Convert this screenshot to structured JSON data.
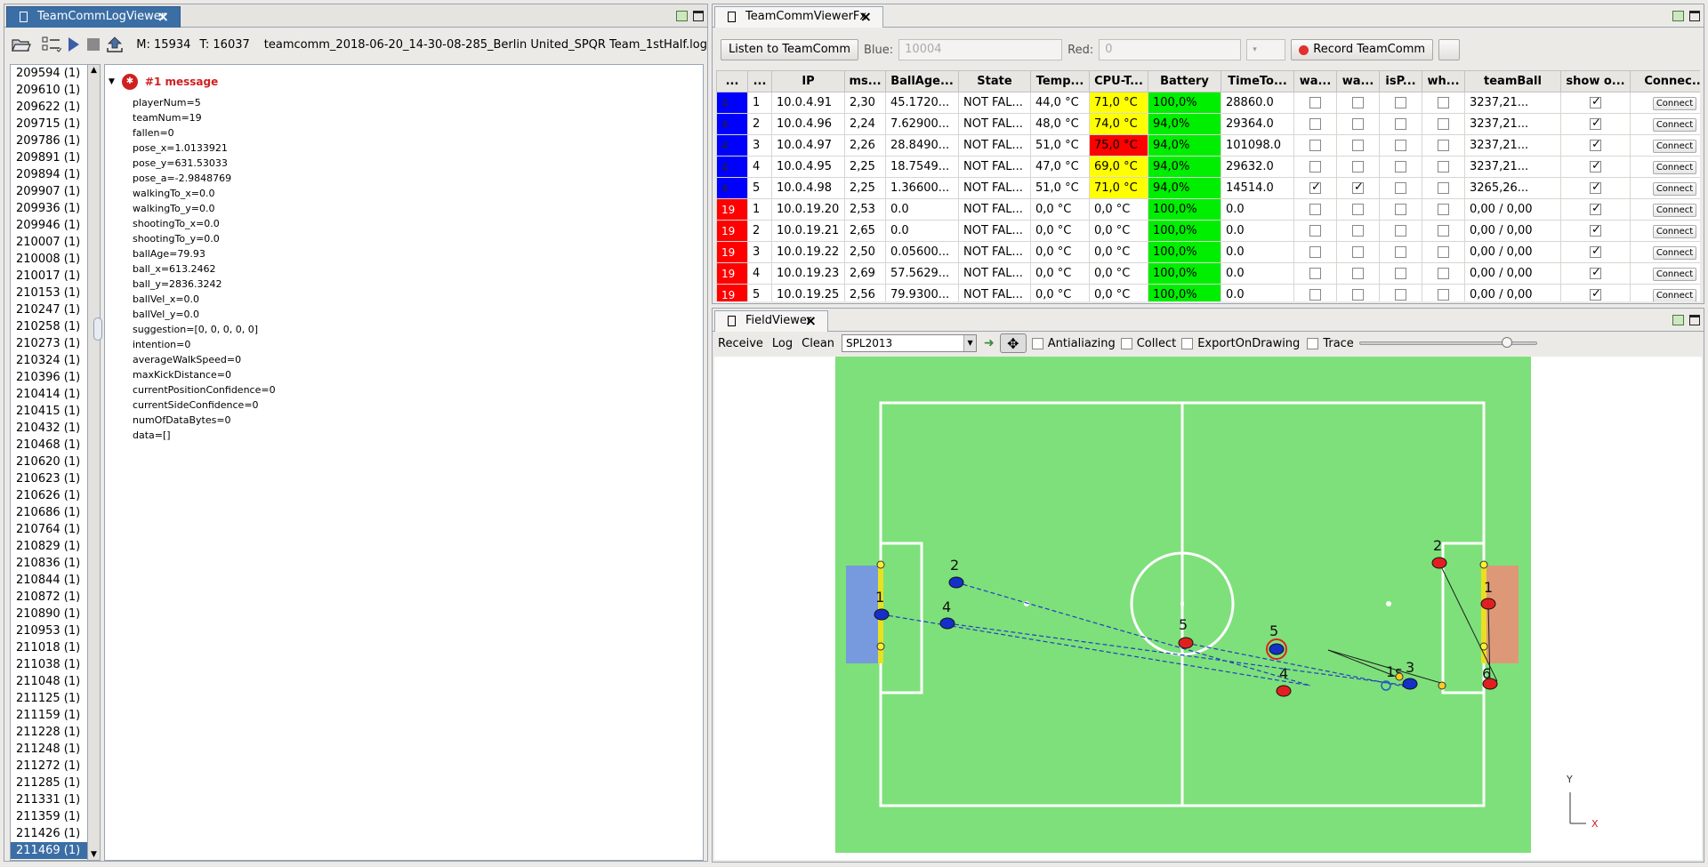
{
  "left_panel": {
    "tab_title": "TeamCommLogViewer",
    "toolbar": {
      "open_icon": "folder-open-icon",
      "filter_icon": "list-check-icon",
      "play_icon": "play-icon",
      "stop_icon": "stop-icon",
      "export_icon": "upload-icon",
      "m_label": "M: 15934",
      "t_label": "T: 16037",
      "filename": "teamcomm_2018-06-20_14-30-08-285_Berlin United_SPQR Team_1stHalf.log"
    },
    "frames": [
      "209594 (1)",
      "209610 (1)",
      "209622 (1)",
      "209715 (1)",
      "209786 (1)",
      "209891 (1)",
      "209894 (1)",
      "209907 (1)",
      "209936 (1)",
      "209946 (1)",
      "210007 (1)",
      "210008 (1)",
      "210017 (1)",
      "210153 (1)",
      "210247 (1)",
      "210258 (1)",
      "210273 (1)",
      "210324 (1)",
      "210396 (1)",
      "210414 (1)",
      "210415 (1)",
      "210432 (1)",
      "210468 (1)",
      "210620 (1)",
      "210623 (1)",
      "210626 (1)",
      "210686 (1)",
      "210764 (1)",
      "210829 (1)",
      "210836 (1)",
      "210844 (1)",
      "210872 (1)",
      "210890 (1)",
      "210953 (1)",
      "211018 (1)",
      "211038 (1)",
      "211048 (1)",
      "211125 (1)",
      "211159 (1)",
      "211228 (1)",
      "211248 (1)",
      "211272 (1)",
      "211285 (1)",
      "211331 (1)",
      "211359 (1)",
      "211426 (1)",
      "211469 (1)"
    ],
    "selected_frame": "211469 (1)",
    "message_header": "#1 message",
    "message_fields": [
      "playerNum=5",
      "teamNum=19",
      "fallen=0",
      "pose_x=1.0133921",
      "pose_y=631.53033",
      "pose_a=-2.9848769",
      "walkingTo_x=0.0",
      "walkingTo_y=0.0",
      "shootingTo_x=0.0",
      "shootingTo_y=0.0",
      "ballAge=79.93",
      "ball_x=613.2462",
      "ball_y=2836.3242",
      "ballVel_x=0.0",
      "ballVel_y=0.0",
      "suggestion=[0, 0, 0, 0, 0]",
      "intention=0",
      "averageWalkSpeed=0",
      "maxKickDistance=0",
      "currentPositionConfidence=0",
      "currentSideConfidence=0",
      "numOfDataBytes=0",
      "data=[]"
    ]
  },
  "teamcomm_panel": {
    "tab_title": "TeamCommViewerFx",
    "listen_button": "Listen to TeamComm",
    "blue_label": "Blue:",
    "blue_value": "10004",
    "red_label": "Red:",
    "red_value": "0",
    "record_button": "Record TeamComm",
    "columns": [
      "...",
      "...",
      "IP",
      "ms...",
      "BallAge...",
      "State",
      "Temp...",
      "CPU-T...",
      "Battery",
      "TimeTo...",
      "wa...",
      "wa...",
      "isP...",
      "wh...",
      "teamBall",
      "show o...",
      "Connec..."
    ],
    "rows": [
      {
        "team": "4",
        "num": "1",
        "ip": "10.0.4.91",
        "ms": "2,30",
        "ballage": "45.1720...",
        "state": "NOT FAL...",
        "temp": "44,0 °C",
        "cpu": "71,0 °C",
        "cpu_color": "#ffff00",
        "battery": "100,0%",
        "timeto": "28860.0",
        "wa1": false,
        "wa2": false,
        "isp": false,
        "wh": false,
        "teamball": "3237,21...",
        "show": true,
        "connect": "Connect",
        "team_color": "#0000ff"
      },
      {
        "team": "4",
        "num": "2",
        "ip": "10.0.4.96",
        "ms": "2,24",
        "ballage": "7.62900...",
        "state": "NOT FAL...",
        "temp": "48,0 °C",
        "cpu": "74,0 °C",
        "cpu_color": "#ffff00",
        "battery": "94,0%",
        "timeto": "29364.0",
        "wa1": false,
        "wa2": false,
        "isp": false,
        "wh": false,
        "teamball": "3237,21...",
        "show": true,
        "connect": "Connect",
        "team_color": "#0000ff"
      },
      {
        "team": "4",
        "num": "3",
        "ip": "10.0.4.97",
        "ms": "2,26",
        "ballage": "28.8490...",
        "state": "NOT FAL...",
        "temp": "51,0 °C",
        "cpu": "75,0 °C",
        "cpu_color": "#ff0000",
        "battery": "94,0%",
        "timeto": "101098.0",
        "wa1": false,
        "wa2": false,
        "isp": false,
        "wh": false,
        "teamball": "3237,21...",
        "show": true,
        "connect": "Connect",
        "team_color": "#0000ff"
      },
      {
        "team": "4",
        "num": "4",
        "ip": "10.0.4.95",
        "ms": "2,25",
        "ballage": "18.7549...",
        "state": "NOT FAL...",
        "temp": "47,0 °C",
        "cpu": "69,0 °C",
        "cpu_color": "#ffff00",
        "battery": "94,0%",
        "timeto": "29632.0",
        "wa1": false,
        "wa2": false,
        "isp": false,
        "wh": false,
        "teamball": "3237,21...",
        "show": true,
        "connect": "Connect",
        "team_color": "#0000ff"
      },
      {
        "team": "4",
        "num": "5",
        "ip": "10.0.4.98",
        "ms": "2,25",
        "ballage": "1.36600...",
        "state": "NOT FAL...",
        "temp": "51,0 °C",
        "cpu": "71,0 °C",
        "cpu_color": "#ffff00",
        "battery": "94,0%",
        "timeto": "14514.0",
        "wa1": true,
        "wa2": true,
        "isp": false,
        "wh": false,
        "teamball": "3265,26...",
        "show": true,
        "connect": "Connect",
        "team_color": "#0000ff"
      },
      {
        "team": "19",
        "num": "1",
        "ip": "10.0.19.20",
        "ms": "2,53",
        "ballage": "0.0",
        "state": "NOT FAL...",
        "temp": "0,0 °C",
        "cpu": "0,0 °C",
        "cpu_color": "#ffffff",
        "battery": "100,0%",
        "timeto": "0.0",
        "wa1": false,
        "wa2": false,
        "isp": false,
        "wh": false,
        "teamball": "0,00 / 0,00",
        "show": true,
        "connect": "Connect",
        "team_color": "#ff0000"
      },
      {
        "team": "19",
        "num": "2",
        "ip": "10.0.19.21",
        "ms": "2,65",
        "ballage": "0.0",
        "state": "NOT FAL...",
        "temp": "0,0 °C",
        "cpu": "0,0 °C",
        "cpu_color": "#ffffff",
        "battery": "100,0%",
        "timeto": "0.0",
        "wa1": false,
        "wa2": false,
        "isp": false,
        "wh": false,
        "teamball": "0,00 / 0,00",
        "show": true,
        "connect": "Connect",
        "team_color": "#ff0000"
      },
      {
        "team": "19",
        "num": "3",
        "ip": "10.0.19.22",
        "ms": "2,50",
        "ballage": "0.05600...",
        "state": "NOT FAL...",
        "temp": "0,0 °C",
        "cpu": "0,0 °C",
        "cpu_color": "#ffffff",
        "battery": "100,0%",
        "timeto": "0.0",
        "wa1": false,
        "wa2": false,
        "isp": false,
        "wh": false,
        "teamball": "0,00 / 0,00",
        "show": true,
        "connect": "Connect",
        "team_color": "#ff0000"
      },
      {
        "team": "19",
        "num": "4",
        "ip": "10.0.19.23",
        "ms": "2,69",
        "ballage": "57.5629...",
        "state": "NOT FAL...",
        "temp": "0,0 °C",
        "cpu": "0,0 °C",
        "cpu_color": "#ffffff",
        "battery": "100,0%",
        "timeto": "0.0",
        "wa1": false,
        "wa2": false,
        "isp": false,
        "wh": false,
        "teamball": "0,00 / 0,00",
        "show": true,
        "connect": "Connect",
        "team_color": "#ff0000"
      },
      {
        "team": "19",
        "num": "5",
        "ip": "10.0.19.25",
        "ms": "2,56",
        "ballage": "79.9300...",
        "state": "NOT FAL...",
        "temp": "0,0 °C",
        "cpu": "0,0 °C",
        "cpu_color": "#ffffff",
        "battery": "100,0%",
        "timeto": "0.0",
        "wa1": false,
        "wa2": false,
        "isp": false,
        "wh": false,
        "teamball": "0,00 / 0,00",
        "show": true,
        "connect": "Connect",
        "team_color": "#ff0000"
      }
    ]
  },
  "field_panel": {
    "tab_title": "FieldViewer",
    "receive": "Receive",
    "log": "Log",
    "clean": "Clean",
    "field_select": "SPL2013",
    "antialiazing": "Antialiazing",
    "collect": "Collect",
    "export_on_drawing": "ExportOnDrawing",
    "trace": "Trace",
    "trace_slider": 0.85,
    "axis_y": "Y",
    "axis_x": "X",
    "colors": {
      "field": "#7ee07a",
      "line": "#ffffff",
      "blue_robot": "#1530c8",
      "red_robot": "#e02020",
      "blue_goal": "#7799dd",
      "red_goal": "#dd9977",
      "goal_post": "#e8e020"
    },
    "robot_labels": {
      "blue1": "1",
      "blue2": "2",
      "blue4": "4",
      "blue5": "5",
      "red2": "2",
      "red1": "1",
      "red4": "4",
      "red5": "5",
      "label1s": "1s",
      "label3": "3",
      "cluster": "6"
    }
  }
}
